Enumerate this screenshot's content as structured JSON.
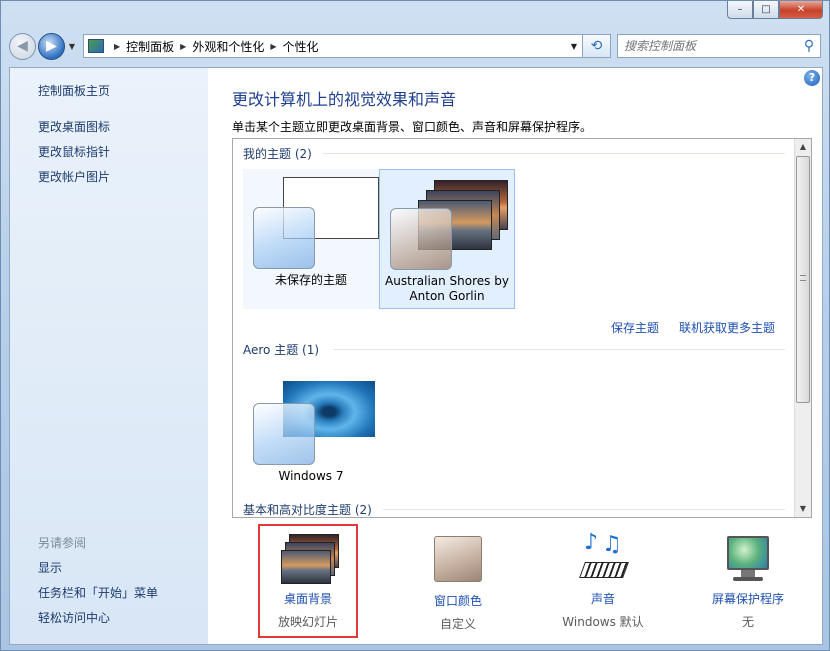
{
  "window": {
    "caption": {
      "minimize": "–",
      "maximize": "□",
      "close": "✕"
    }
  },
  "address": {
    "crumbs": [
      "控制面板",
      "外观和个性化",
      "个性化"
    ],
    "search_placeholder": "搜索控制面板"
  },
  "sidebar": {
    "items": [
      "控制面板主页",
      "更改桌面图标",
      "更改鼠标指针",
      "更改帐户图片"
    ],
    "see_also_heading": "另请参阅",
    "see_also": [
      "显示",
      "任务栏和「开始」菜单",
      "轻松访问中心"
    ]
  },
  "main": {
    "title": "更改计算机上的视觉效果和声音",
    "subtitle": "单击某个主题立即更改桌面背景、窗口颜色、声音和屏幕保护程序。",
    "help": "?"
  },
  "themes": {
    "my_heading": "我的主题 (2)",
    "my": [
      {
        "label": "未保存的主题"
      },
      {
        "label_line1": "Australian Shores by",
        "label_line2": "Anton Gorlin"
      }
    ],
    "save_link": "保存主题",
    "online_link": "联机获取更多主题",
    "aero_heading": "Aero 主题 (1)",
    "aero": [
      {
        "label": "Windows 7"
      }
    ],
    "basic_heading": "基本和高对比度主题 (2)"
  },
  "bottom": [
    {
      "label": "桌面背景",
      "value": "放映幻灯片",
      "icon": "slideshow-icon"
    },
    {
      "label": "窗口颜色",
      "value": "自定义",
      "icon": "color-icon"
    },
    {
      "label": "声音",
      "value": "Windows 默认",
      "icon": "sound-icon"
    },
    {
      "label": "屏幕保护程序",
      "value": "无",
      "icon": "screensaver-icon"
    }
  ],
  "colors": {
    "link": "#1e4fb0",
    "title": "#1f3f8f",
    "highlight": "#e23a3a"
  }
}
